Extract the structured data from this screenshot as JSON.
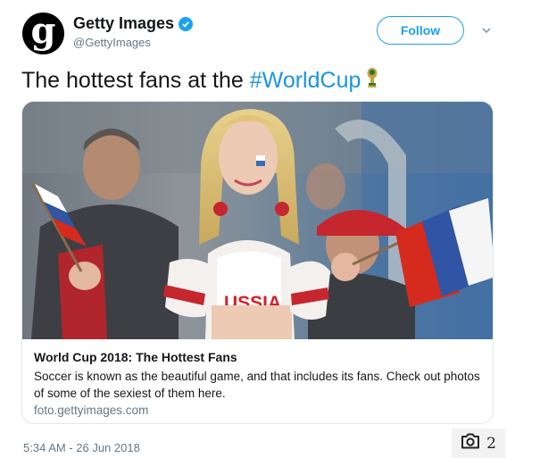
{
  "author": {
    "name": "Getty Images",
    "handle": "@GettyImages",
    "avatar_letter": "g",
    "verified": true
  },
  "actions": {
    "follow_label": "Follow",
    "more_icon": "chevron-down-icon"
  },
  "tweet": {
    "text": "The hottest fans at the",
    "hashtag": "#WorldCup",
    "emoji_icon": "world-cup-trophy-icon"
  },
  "card": {
    "image_overlay_text": "USSIA",
    "title": "World Cup 2018: The Hottest Fans",
    "description": "Soccer is known as the beautiful game, and that includes its fans. Check out photos of some of the sexiest of them here.",
    "domain": "foto.gettyimages.com"
  },
  "meta": {
    "timestamp": "5:34 AM - 26 Jun 2018"
  },
  "gallery": {
    "icon": "camera-icon",
    "count": "2"
  },
  "colors": {
    "link_blue": "#1b95e0",
    "follow_blue": "#1da1f2",
    "muted_gray": "#657786"
  }
}
